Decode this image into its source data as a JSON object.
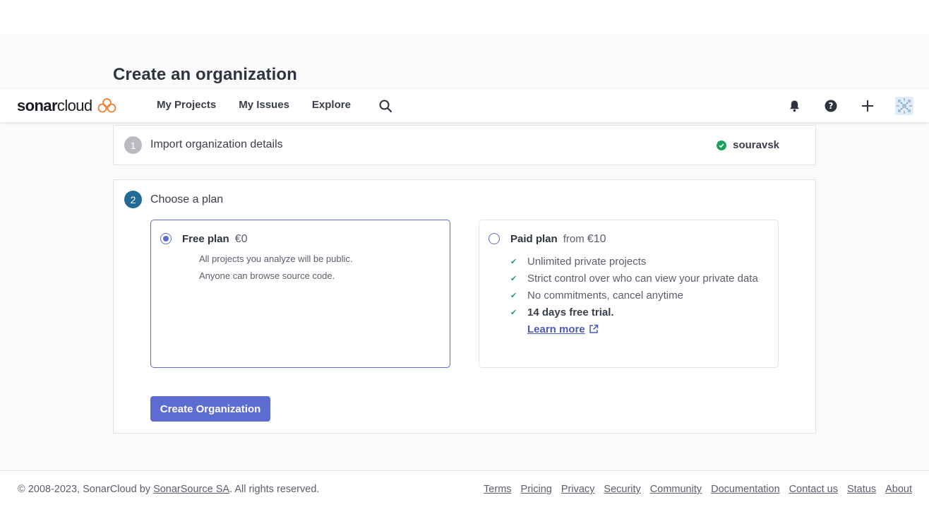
{
  "page": {
    "title": "Create an organization"
  },
  "navbar": {
    "logo_text_bold": "sonar",
    "logo_text_regular": "cloud",
    "links": [
      "My Projects",
      "My Issues",
      "Explore"
    ],
    "icons": [
      "search-icon",
      "bell-icon",
      "help-icon",
      "plus-icon",
      "avatar"
    ]
  },
  "step1": {
    "number": "1",
    "title": "Import organization details",
    "org_name": "souravsk"
  },
  "step2": {
    "number": "2",
    "title": "Choose a plan",
    "free_plan": {
      "name": "Free plan",
      "price": "€0",
      "selected": true,
      "lines": [
        "All projects you analyze will be public.",
        "Anyone can browse source code."
      ]
    },
    "paid_plan": {
      "name": "Paid plan",
      "price_prefix": "from",
      "price": "€10",
      "selected": false,
      "features": [
        "Unlimited private projects",
        "Strict control over who can view your private data",
        "No commitments, cancel anytime"
      ],
      "trial": "14 days free trial.",
      "learn_more": "Learn more"
    },
    "create_button": "Create Organization"
  },
  "footer": {
    "copyright_prefix": "© 2008-2023, SonarCloud by ",
    "company": "SonarSource SA",
    "copyright_suffix": ". All rights reserved.",
    "links": [
      "Terms",
      "Pricing",
      "Privacy",
      "Security",
      "Community",
      "Documentation",
      "Contact us",
      "Status",
      "About"
    ]
  },
  "colors": {
    "accent": "#5d6cd0",
    "success": "#1aa25d",
    "step_active": "#236a97",
    "sonar_orange": "#f37a2a"
  }
}
